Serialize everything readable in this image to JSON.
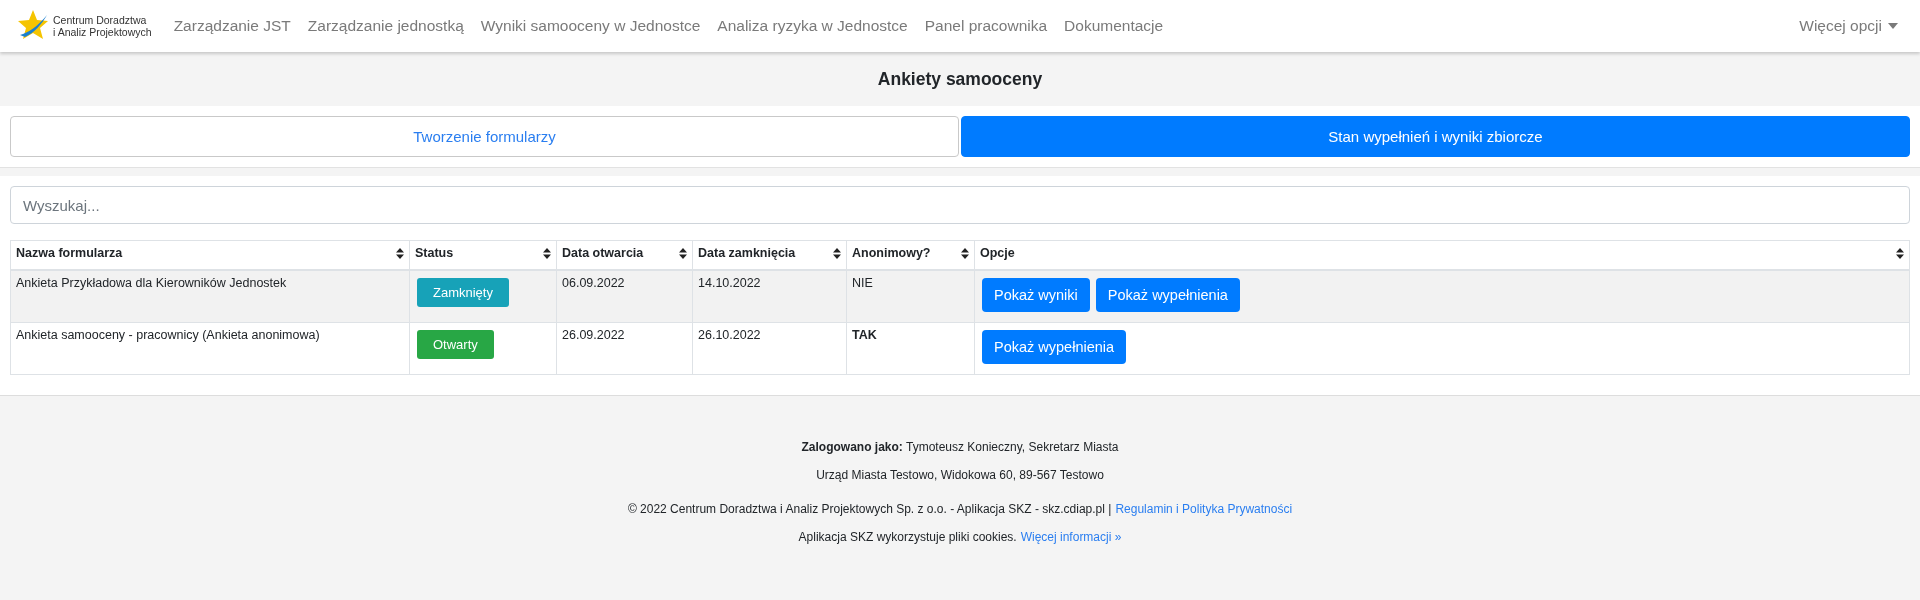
{
  "navbar": {
    "logo_lines": [
      "Centrum Doradztwa",
      "i Analiz Projektowych"
    ],
    "links": [
      "Zarządzanie JST",
      "Zarządzanie jednostką",
      "Wyniki samooceny w Jednostce",
      "Analiza ryzyka w Jednostce",
      "Panel pracownika",
      "Dokumentacje"
    ],
    "more": "Więcej opcji"
  },
  "page_title": "Ankiety samooceny",
  "tabs": [
    {
      "label": "Tworzenie formularzy",
      "selected": false
    },
    {
      "label": "Stan wypełnień i wyniki zbiorcze",
      "selected": true
    }
  ],
  "search": {
    "placeholder": "Wyszukaj..."
  },
  "table": {
    "columns": [
      "Nazwa formularza",
      "Status",
      "Data otwarcia",
      "Data zamknięcia",
      "Anonimowy?",
      "Opcje"
    ],
    "rows": [
      {
        "name": "Ankieta Przykładowa dla Kierowników Jednostek",
        "status": {
          "label": "Zamknięty",
          "color": "#17a2b8"
        },
        "opened": "06.09.2022",
        "closed": "14.10.2022",
        "anonymous": {
          "text": "NIE",
          "bold": false
        },
        "buttons": [
          "Pokaż wyniki",
          "Pokaż wypełnienia"
        ]
      },
      {
        "name": "Ankieta samooceny - pracownicy (Ankieta anonimowa)",
        "status": {
          "label": "Otwarty",
          "color": "#28a745"
        },
        "opened": "26.09.2022",
        "closed": "26.10.2022",
        "anonymous": {
          "text": "TAK",
          "bold": true
        },
        "buttons": [
          "Pokaż wypełnienia"
        ]
      }
    ]
  },
  "footer": {
    "logged_in": "**Zalogowano jako:** Tymoteusz Konieczny, Sekretarz Miasta",
    "address": "Urząd Miasta Testowo, Widokowa 60, 89-567 Testowo",
    "copyright": "© 2022 Centrum Doradztwa i Analiz Projektowych Sp. z o.o. - Aplikacja SKZ - skz.cdiap.pl |",
    "policy_link": "Regulamin i Polityka Prywatności",
    "cookies": "Aplikacja SKZ wykorzystuje pliki cookies.",
    "more_info_link": "Więcej informacji »"
  }
}
